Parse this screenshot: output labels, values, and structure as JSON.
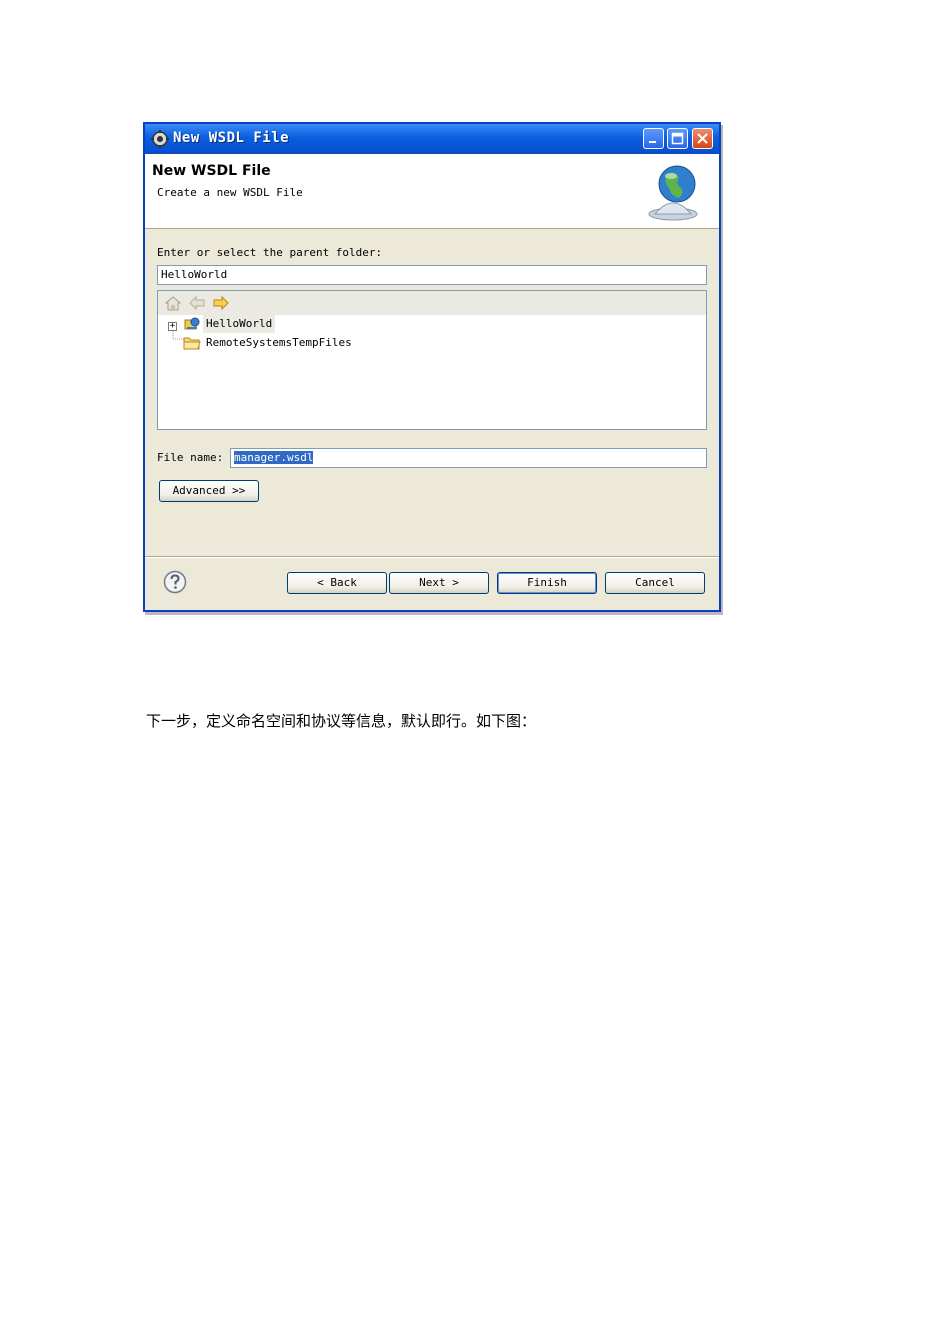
{
  "dialog": {
    "window_title": "New WSDL File",
    "header_title": "New WSDL File",
    "header_subtitle": "Create a new WSDL File",
    "parent_folder_label": "Enter or select the parent folder:",
    "parent_folder_value": "HelloWorld",
    "tree_items": [
      {
        "label": "HelloWorld",
        "icon": "project-icon",
        "expandable": true,
        "selected": true
      },
      {
        "label": "RemoteSystemsTempFiles",
        "icon": "folder-icon",
        "expandable": false,
        "selected": false
      }
    ],
    "file_name_label": "File name:",
    "file_name_value": "manager.wsdl",
    "advanced_label": "Advanced >>",
    "buttons": {
      "back": "< Back",
      "next": "Next >",
      "finish": "Finish",
      "cancel": "Cancel"
    }
  },
  "caption": "下一步，定义命名空间和协议等信息，默认即行。如下图：",
  "colors": {
    "titlebar": "#0a5ee0",
    "dialog_bg": "#ece9d8",
    "selection": "#316ac5"
  }
}
